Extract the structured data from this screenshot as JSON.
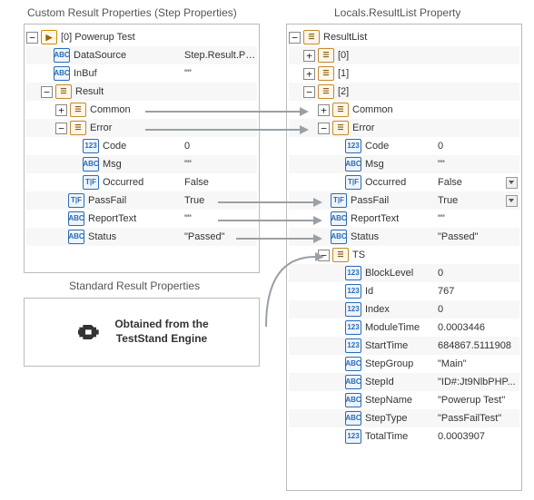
{
  "titles": {
    "left": "Custom Result Properties (Step Properties)",
    "right": "Locals.ResultList Property",
    "std": "Standard Result Properties"
  },
  "engine": {
    "line1": "Obtained from the",
    "line2": "TestStand Engine"
  },
  "icons": {
    "powerup": "▶",
    "abc": "ABC",
    "container": "☰",
    "num": "123",
    "tf": "T|F",
    "list": "☰"
  },
  "left": {
    "root": "[0] Powerup Test",
    "dataSource": {
      "name": "DataSource",
      "value": "Step.Result.PassFail"
    },
    "inBuf": {
      "name": "InBuf",
      "value": "\"\""
    },
    "result": "Result",
    "common": "Common",
    "error": "Error",
    "code": {
      "name": "Code",
      "value": "0"
    },
    "msg": {
      "name": "Msg",
      "value": "\"\""
    },
    "occurred": {
      "name": "Occurred",
      "value": "False"
    },
    "passFail": {
      "name": "PassFail",
      "value": "True"
    },
    "reportText": {
      "name": "ReportText",
      "value": "\"\""
    },
    "status": {
      "name": "Status",
      "value": "\"Passed\""
    }
  },
  "right": {
    "root": "ResultList",
    "i0": "[0]",
    "i1": "[1]",
    "i2": "[2]",
    "common": "Common",
    "error": "Error",
    "code": {
      "name": "Code",
      "value": "0"
    },
    "msg": {
      "name": "Msg",
      "value": "\"\""
    },
    "occurred": {
      "name": "Occurred",
      "value": "False"
    },
    "passFail": {
      "name": "PassFail",
      "value": "True"
    },
    "reportText": {
      "name": "ReportText",
      "value": "\"\""
    },
    "status": {
      "name": "Status",
      "value": "\"Passed\""
    },
    "ts": "TS",
    "blockLevel": {
      "name": "BlockLevel",
      "value": "0"
    },
    "id": {
      "name": "Id",
      "value": "767"
    },
    "index": {
      "name": "Index",
      "value": "0"
    },
    "moduleTime": {
      "name": "ModuleTime",
      "value": "0.0003446"
    },
    "startTime": {
      "name": "StartTime",
      "value": "684867.5111908"
    },
    "stepGroup": {
      "name": "StepGroup",
      "value": "\"Main\""
    },
    "stepId": {
      "name": "StepId",
      "value": "\"ID#:Jt9NlbPHP..."
    },
    "stepName": {
      "name": "StepName",
      "value": "\"Powerup Test\""
    },
    "stepType": {
      "name": "StepType",
      "value": "\"PassFailTest\""
    },
    "totalTime": {
      "name": "TotalTime",
      "value": "0.0003907"
    }
  }
}
